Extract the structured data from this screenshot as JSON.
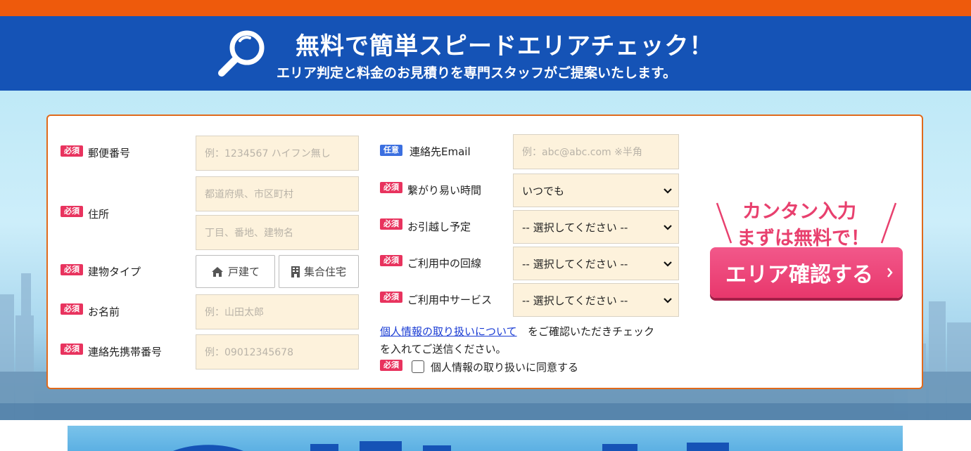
{
  "header": {
    "title": "無料で簡単スピードエリアチェック！",
    "subtitle": "エリア判定と料金のお見積りを専門スタッフがご提案いたします。"
  },
  "badges": {
    "required": "必須",
    "optional": "任意"
  },
  "form": {
    "postal": {
      "label": "郵便番号",
      "placeholder": "例：1234567 ハイフン無し"
    },
    "address": {
      "label": "住所",
      "placeholder1": "都道府県、市区町村",
      "placeholder2": "丁目、番地、建物名"
    },
    "building_type": {
      "label": "建物タイプ",
      "options": [
        "戸建て",
        "集合住宅"
      ]
    },
    "name": {
      "label": "お名前",
      "placeholder": "例：山田太郎"
    },
    "phone": {
      "label": "連絡先携帯番号",
      "placeholder": "例：09012345678"
    },
    "email": {
      "label": "連絡先Email",
      "placeholder": "例：abc@abc.com ※半角"
    },
    "contact_time": {
      "label": "繋がり易い時間",
      "value": "いつでも"
    },
    "moving": {
      "label": "お引越し予定",
      "value": "-- 選択してください --"
    },
    "line": {
      "label": "ご利用中の回線",
      "value": "-- 選択してください --"
    },
    "service": {
      "label": "ご利用中サービス",
      "value": "-- 選択してください --"
    },
    "privacy": {
      "link_text": "個人情報の取り扱いについて",
      "note_rest": " をご確認いただきチェック",
      "note_line2": "を入れてご送信ください。",
      "agree_label": "個人情報の取り扱いに同意する"
    }
  },
  "promo": {
    "line1": "カンタン入力",
    "line2": "まずは無料で！"
  },
  "cta": {
    "label": "エリア確認する"
  },
  "colors": {
    "orange": "#ee5a0c",
    "blue": "#1553b6",
    "pink": "#e8376c",
    "input_bg": "#fdf2dc"
  }
}
